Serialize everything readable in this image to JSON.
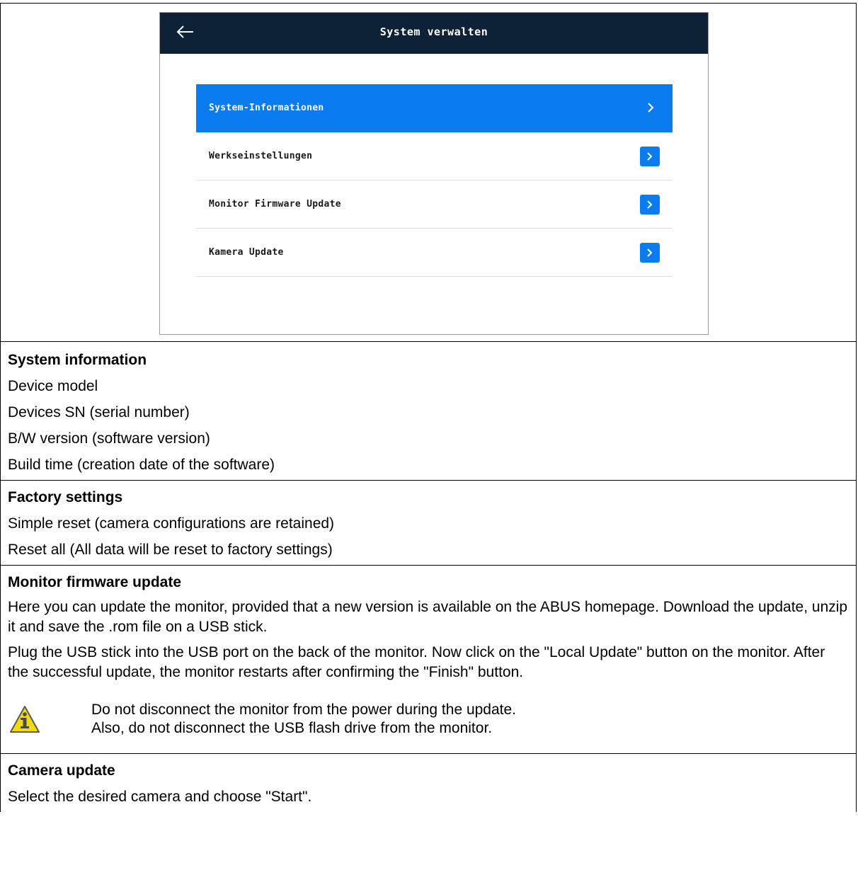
{
  "device_ui": {
    "title": "System verwalten",
    "back_icon": "arrow-left-icon",
    "menu": [
      {
        "label": "System-Informationen",
        "active": true
      },
      {
        "label": "Werkseinstellungen",
        "active": false
      },
      {
        "label": "Monitor Firmware Update",
        "active": false
      },
      {
        "label": "Kamera Update",
        "active": false
      }
    ],
    "colors": {
      "header": "#0d2236",
      "accent": "#0a7cf0"
    }
  },
  "sections": {
    "system_info": {
      "title": "System information",
      "lines": [
        "Device model",
        "Devices SN (serial number)",
        "B/W version (software version)",
        "Build time (creation date of the software)"
      ]
    },
    "factory": {
      "title": "Factory settings",
      "lines": [
        "Simple reset (camera configurations are retained)",
        "Reset all (All data will be reset to factory settings)"
      ]
    },
    "monitor_update": {
      "title": "Monitor firmware update",
      "para1": "Here you can update the monitor, provided that a new version is available on the ABUS homepage. Download the update, unzip it and save the .rom file on a USB stick.",
      "para2": "Plug the USB stick into the USB port on the back of the monitor. Now click on the \"Local Update\" button on the monitor. After the successful update, the monitor restarts after confirming the \"Finish\" button.",
      "warning_icon": "info-warning-icon",
      "warning_line1": "Do not disconnect the monitor from the power during the update.",
      "warning_line2": "Also, do not disconnect the USB flash drive from the monitor."
    },
    "camera_update": {
      "title": "Camera update",
      "text": "Select the desired camera and choose \"Start\"."
    }
  }
}
